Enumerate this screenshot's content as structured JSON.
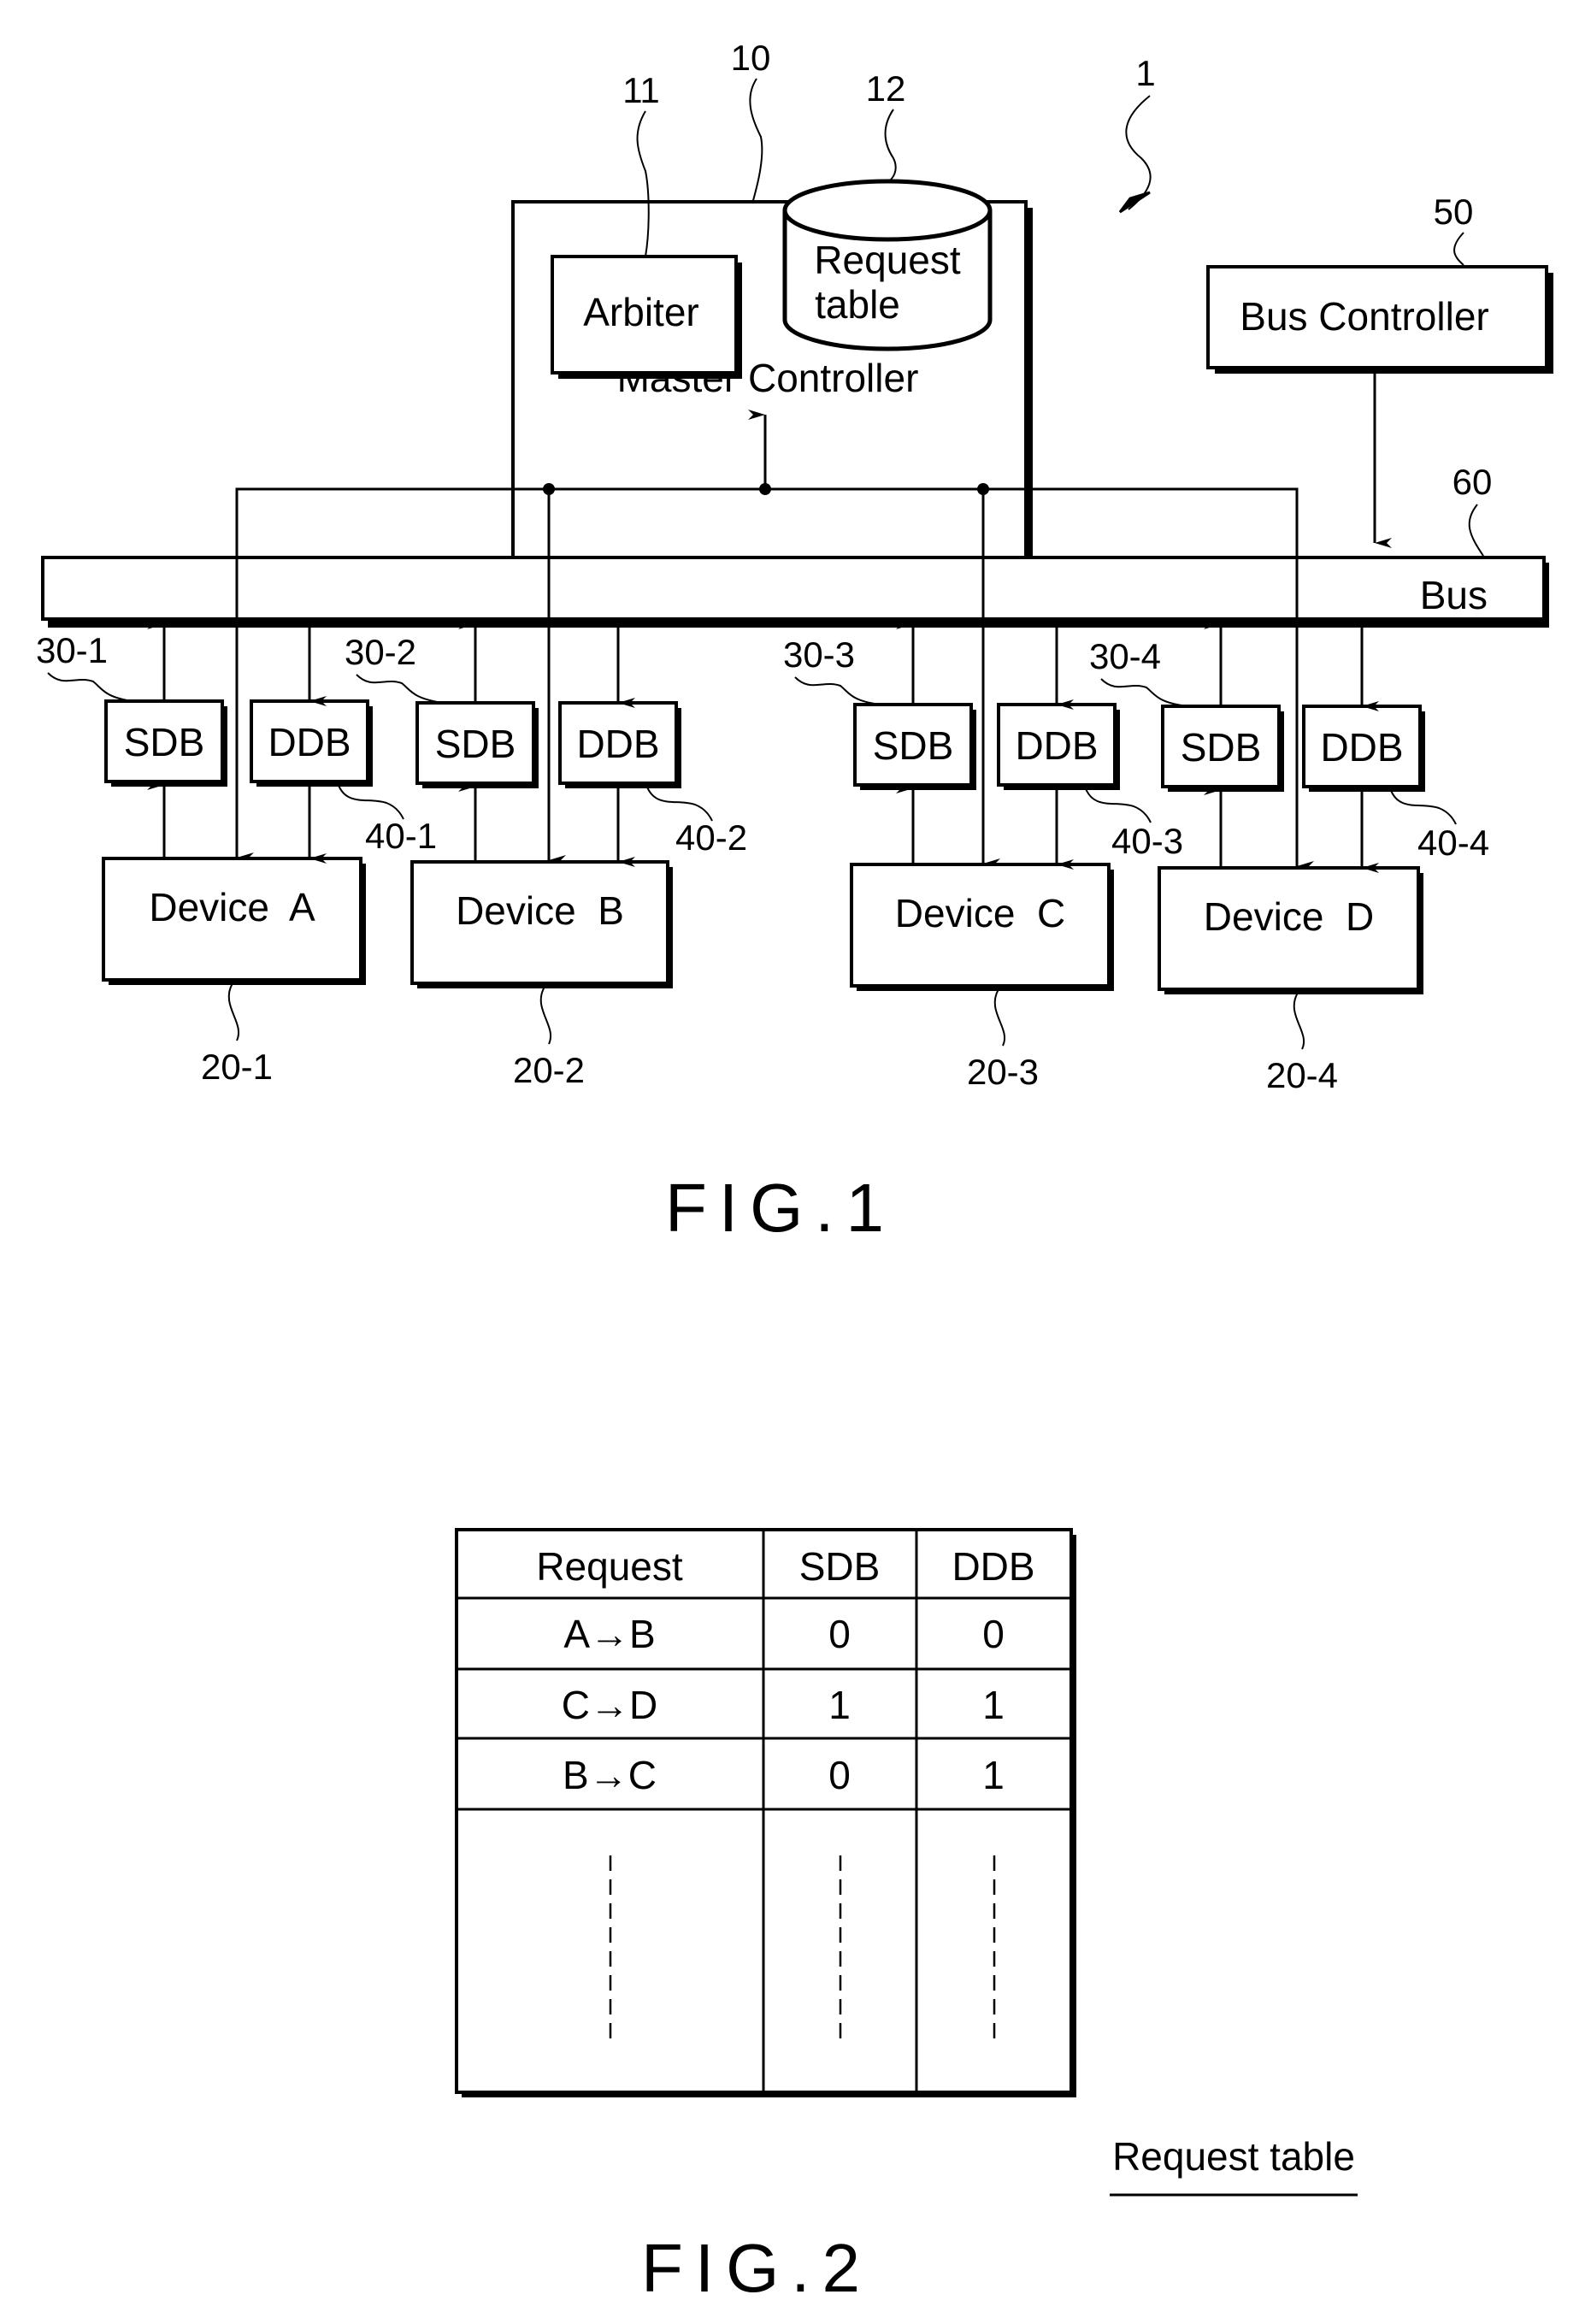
{
  "figure1": {
    "caption": "FIG.1",
    "system_ref": "1",
    "master_controller": {
      "label": "Master Controller",
      "ref": "10"
    },
    "arbiter": {
      "label": "Arbiter",
      "ref": "11"
    },
    "request_table_store": {
      "label_line1": "Request",
      "label_line2": "table",
      "ref": "12"
    },
    "bus_controller": {
      "label": "Bus Controller",
      "ref": "50"
    },
    "bus": {
      "label": "Bus",
      "ref": "60"
    },
    "devices": [
      {
        "label": "Device  A",
        "ref": "20-1",
        "sdb": "SDB",
        "sdb_ref": "30-1",
        "ddb": "DDB",
        "ddb_ref": "40-1"
      },
      {
        "label": "Device  B",
        "ref": "20-2",
        "sdb": "SDB",
        "sdb_ref": "30-2",
        "ddb": "DDB",
        "ddb_ref": "40-2"
      },
      {
        "label": "Device  C",
        "ref": "20-3",
        "sdb": "SDB",
        "sdb_ref": "30-3",
        "ddb": "DDB",
        "ddb_ref": "40-3"
      },
      {
        "label": "Device  D",
        "ref": "20-4",
        "sdb": "SDB",
        "sdb_ref": "30-4",
        "ddb": "DDB",
        "ddb_ref": "40-4"
      }
    ]
  },
  "figure2": {
    "caption": "FIG.2",
    "table_title": "Request table",
    "columns": [
      "Request",
      "SDB",
      "DDB"
    ],
    "rows": [
      [
        "A→B",
        "0",
        "0"
      ],
      [
        "C→D",
        "1",
        "1"
      ],
      [
        "B→C",
        "0",
        "1"
      ]
    ]
  }
}
